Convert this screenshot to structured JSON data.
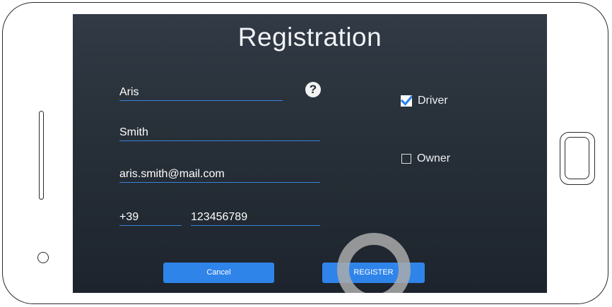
{
  "screen": {
    "title": "Registration"
  },
  "form": {
    "first_name": {
      "value": "Aris",
      "placeholder": ""
    },
    "last_name": {
      "value": "Smith",
      "placeholder": ""
    },
    "email": {
      "value": "aris.smith@mail.com",
      "placeholder": ""
    },
    "phone_prefix": {
      "value": "+39",
      "placeholder": ""
    },
    "phone_number": {
      "value": "123456789",
      "placeholder": ""
    },
    "help_icon": "question-mark",
    "help_glyph": "?"
  },
  "roles": [
    {
      "label": "Driver",
      "checked": true
    },
    {
      "label": "Owner",
      "checked": false
    }
  ],
  "buttons": {
    "cancel": "Cancel",
    "register": "REGISTER"
  },
  "colors": {
    "accent": "#2f84ea",
    "underline": "#3a82d9",
    "screen_background": "#283039",
    "tap_indicator": "#aaaaaa"
  }
}
